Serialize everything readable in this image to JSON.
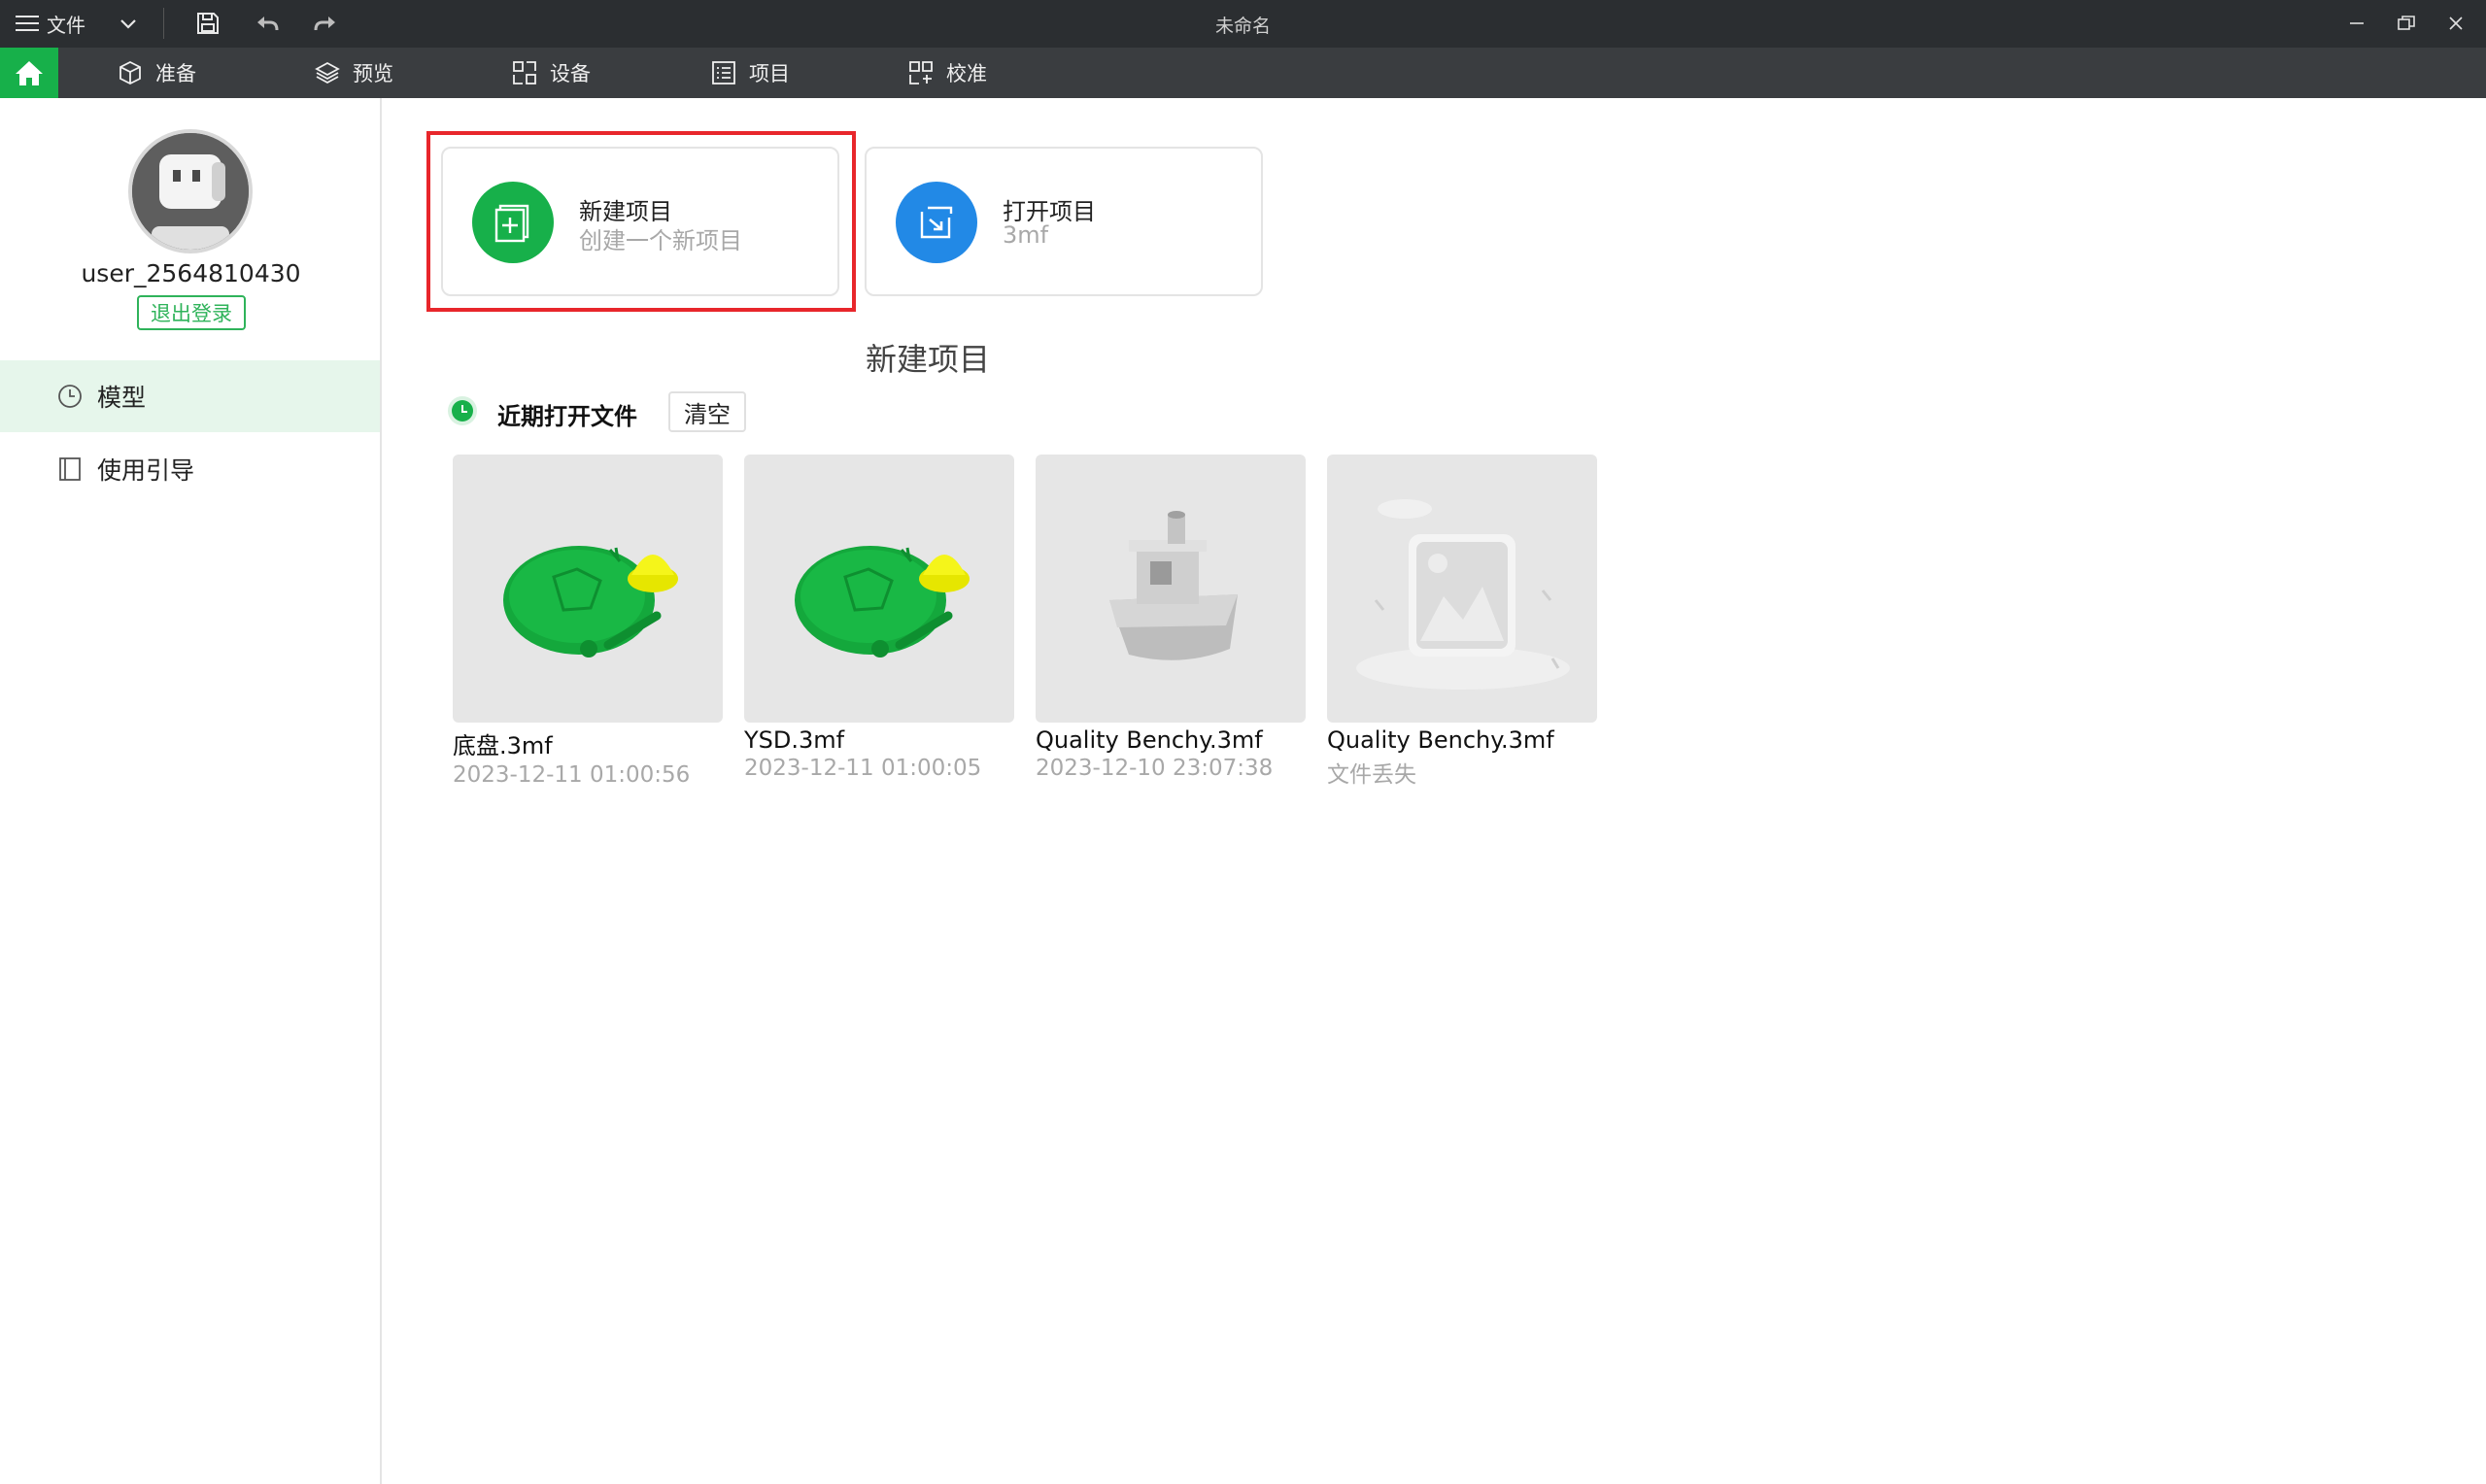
{
  "window": {
    "file_menu_label": "文件",
    "title": "未命名"
  },
  "tabs": [
    {
      "label": "准备",
      "icon": "cube-icon"
    },
    {
      "label": "预览",
      "icon": "layers-icon"
    },
    {
      "label": "设备",
      "icon": "device-icon"
    },
    {
      "label": "项目",
      "icon": "list-icon"
    },
    {
      "label": "校准",
      "icon": "calibrate-icon"
    }
  ],
  "user": {
    "name": "user_2564810430",
    "logout_label": "退出登录"
  },
  "sidebar": {
    "items": [
      {
        "label": "模型",
        "icon": "clock-icon",
        "active": true
      },
      {
        "label": "使用引导",
        "icon": "book-icon",
        "active": false
      }
    ]
  },
  "actions": {
    "new_project": {
      "title": "新建项目",
      "subtitle": "创建一个新项目",
      "color": "#17b04a"
    },
    "open_project": {
      "title": "打开项目",
      "subtitle": "3mf",
      "color": "#2289e6"
    },
    "tooltip": "新建项目"
  },
  "recent": {
    "title": "近期打开文件",
    "clear_label": "清空",
    "files": [
      {
        "name": "底盘.3mf",
        "date": "2023-12-11 01:00:56",
        "thumb": "green-disc-model"
      },
      {
        "name": "YSD.3mf",
        "date": "2023-12-11 01:00:05",
        "thumb": "green-disc-model"
      },
      {
        "name": "Quality Benchy.3mf",
        "date": "2023-12-10 23:07:38",
        "thumb": "benchy-boat-model"
      },
      {
        "name": "Quality Benchy.3mf",
        "date": "文件丢失",
        "thumb": "missing-image-placeholder"
      }
    ]
  },
  "colors": {
    "accent": "#17b04a",
    "highlight": "#e8262b",
    "titlebar": "#2b2e31",
    "tabbar": "#3a3d40"
  }
}
